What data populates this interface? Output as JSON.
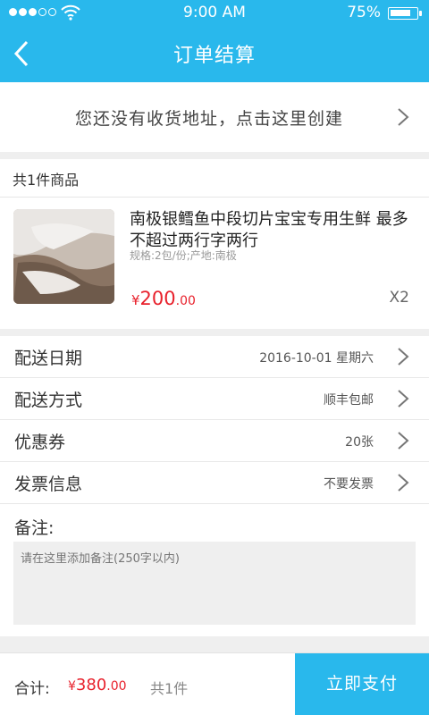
{
  "status_bar": {
    "time": "9:00 AM",
    "battery": "75%"
  },
  "header": {
    "title": "订单结算"
  },
  "address": {
    "prompt": "您还没有收货地址，点击这里创建"
  },
  "goods": {
    "count_label": "共1件商品",
    "item": {
      "name": "南极银鳕鱼中段切片宝宝专用生鲜 最多不超过两行字两行",
      "spec": "规格:2包/份;产地:南极",
      "price_symbol": "¥",
      "price_int": "200",
      "price_dec": ".00",
      "quantity": "X2"
    }
  },
  "options": [
    {
      "label": "配送日期",
      "value": "2016-10-01 星期六"
    },
    {
      "label": "配送方式",
      "value": "顺丰包邮"
    },
    {
      "label": "优惠券",
      "value": "20张"
    },
    {
      "label": "发票信息",
      "value": "不要发票"
    }
  ],
  "memo": {
    "label": "备注:",
    "placeholder": "请在这里添加备注(250字以内)"
  },
  "footer": {
    "total_label": "合计:",
    "total_symbol": "¥",
    "total_int": "380",
    "total_dec": ".00",
    "count": "共1件",
    "pay_button": "立即支付"
  },
  "colors": {
    "accent": "#29b8ec",
    "price": "#e8212c"
  }
}
